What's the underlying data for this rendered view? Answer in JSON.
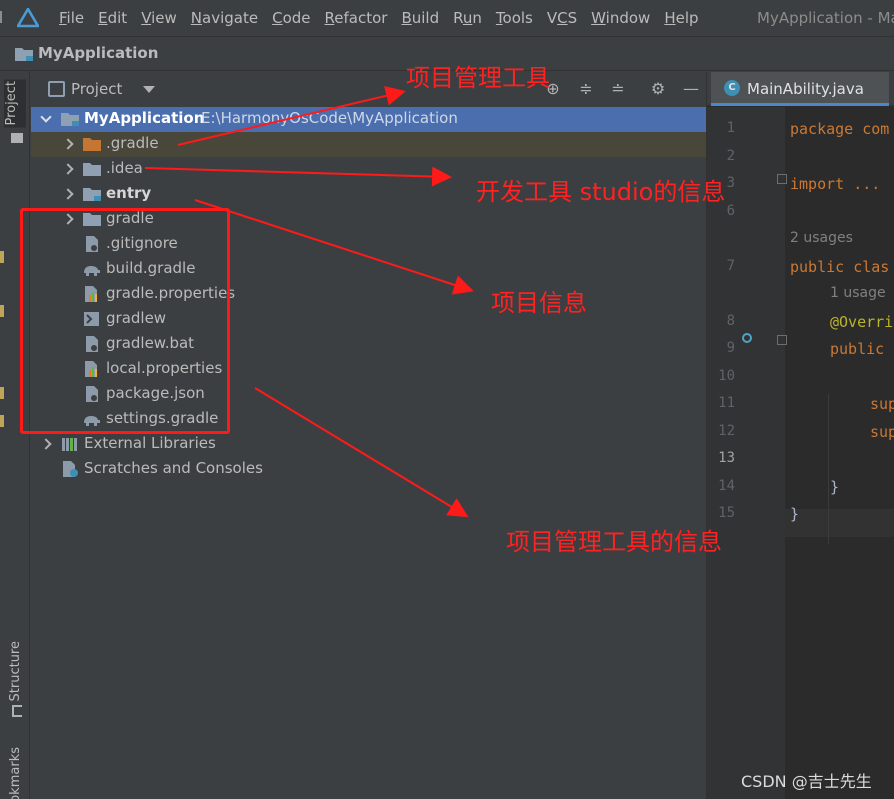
{
  "menubar": {
    "items": [
      "File",
      "Edit",
      "View",
      "Navigate",
      "Code",
      "Refactor",
      "Build",
      "Run",
      "Tools",
      "VCS",
      "Window",
      "Help"
    ],
    "underline_index": [
      0,
      0,
      0,
      0,
      0,
      0,
      0,
      1,
      0,
      1,
      0,
      0
    ],
    "window_title": "MyApplication - Ma"
  },
  "navbar": {
    "title": "MyApplication"
  },
  "tool_stripe": {
    "project": "Project",
    "structure": "Structure",
    "bookmarks": "Bookmarks"
  },
  "project_panel": {
    "title": "Project",
    "tree": [
      {
        "label": "MyApplication",
        "path": "E:\\HarmonyOsCode\\MyApplication",
        "level": 0,
        "expanded": true,
        "icon": "module-folder-icon",
        "bold": true
      },
      {
        "label": ".gradle",
        "level": 1,
        "expanded": false,
        "icon": "folder-orange-icon"
      },
      {
        "label": ".idea",
        "level": 1,
        "expanded": false,
        "icon": "folder-icon"
      },
      {
        "label": "entry",
        "level": 1,
        "expanded": false,
        "icon": "module-folder-icon",
        "bold": true
      },
      {
        "label": "gradle",
        "level": 1,
        "expanded": false,
        "icon": "folder-icon"
      },
      {
        "label": ".gitignore",
        "level": 1,
        "icon": "gitignore-file-icon"
      },
      {
        "label": "build.gradle",
        "level": 1,
        "icon": "gradle-elephant-icon"
      },
      {
        "label": "gradle.properties",
        "level": 1,
        "icon": "properties-file-icon"
      },
      {
        "label": "gradlew",
        "level": 1,
        "icon": "shell-script-icon"
      },
      {
        "label": "gradlew.bat",
        "level": 1,
        "icon": "text-file-icon"
      },
      {
        "label": "local.properties",
        "level": 1,
        "icon": "properties-file-icon"
      },
      {
        "label": "package.json",
        "level": 1,
        "icon": "json-file-icon"
      },
      {
        "label": "settings.gradle",
        "level": 1,
        "icon": "gradle-elephant-icon"
      },
      {
        "label": "External Libraries",
        "level": 0,
        "expanded": false,
        "icon": "libraries-icon"
      },
      {
        "label": "Scratches and Consoles",
        "level": 0,
        "icon": "scratches-icon"
      }
    ]
  },
  "annotations": {
    "a1": "项目管理工具",
    "a2": "开发工具 studio的信息",
    "a3": "项目信息",
    "a4": "项目管理工具的信息"
  },
  "editor": {
    "tab_label": "MainAbility.java",
    "tab_icon_letter": "C",
    "lines": [
      {
        "num": "1",
        "code": "package com"
      },
      {
        "num": "2",
        "code": ""
      },
      {
        "num": "3",
        "code": "import ..."
      },
      {
        "num": "6",
        "code": ""
      },
      {
        "num": "",
        "hint": "2 usages"
      },
      {
        "num": "7",
        "code": "public clas"
      },
      {
        "num": "",
        "hint": "1 usage"
      },
      {
        "num": "8",
        "code": "@Overri"
      },
      {
        "num": "9",
        "code": "public"
      },
      {
        "num": "10",
        "code": ""
      },
      {
        "num": "11",
        "code": "sup"
      },
      {
        "num": "12",
        "code": "sup"
      },
      {
        "num": "13",
        "code": ""
      },
      {
        "num": "14",
        "code": "}"
      },
      {
        "num": "15",
        "code": "}"
      }
    ]
  },
  "watermark": "CSDN @吉士先生"
}
